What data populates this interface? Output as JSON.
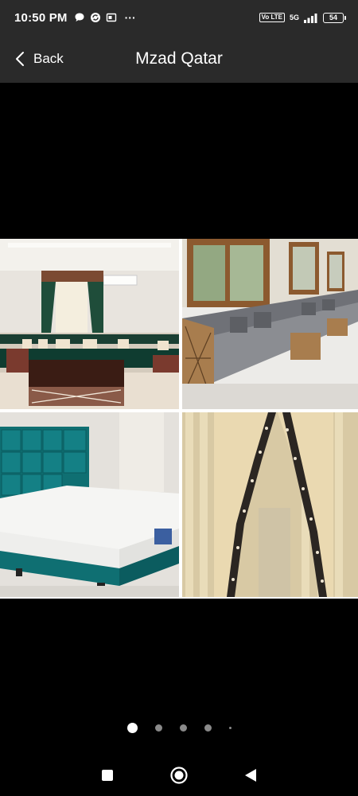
{
  "status_bar": {
    "time": "10:50 PM",
    "more": "···",
    "volte": "Vo LTE",
    "network": "5G",
    "battery": "54"
  },
  "header": {
    "back_label": "Back",
    "title": "Mzad Qatar"
  },
  "gallery": {
    "pages": 5,
    "current_page": 1,
    "images": [
      {
        "name": "majlis-sofa-green"
      },
      {
        "name": "majlis-sofa-grey"
      },
      {
        "name": "bed-mattress-teal"
      },
      {
        "name": "curtains-cream"
      }
    ]
  },
  "nav": {
    "icons": [
      "recents-icon",
      "home-icon",
      "back-icon"
    ]
  },
  "colors": {
    "bar_background": "#2a2a2a",
    "page_background": "#000000",
    "dot_inactive": "#8a8a8a",
    "dot_active": "#ffffff"
  }
}
